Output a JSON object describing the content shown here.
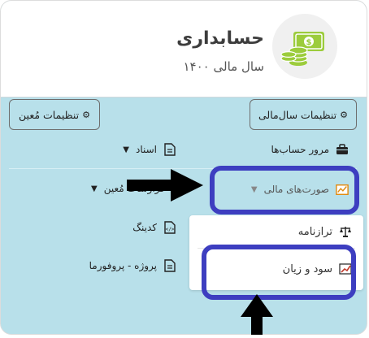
{
  "app": {
    "title": "حسابداری",
    "subtitle": "سال مالی ۱۴۰۰"
  },
  "toolbar": {
    "fiscal_settings_label": "تنظیمات سال‌مالی",
    "moein_settings_label": "تنظیمات مُعین"
  },
  "menu": {
    "accounts_overview": "مرور حساب‌ها",
    "documents": "اسناد",
    "financial_statements": "صورت‌های مالی",
    "moein_reports": "گزارشات مُعین",
    "coding": "کدینگ",
    "project_proforma": "پروژه - پروفورما"
  },
  "dropdown": {
    "balance_sheet": "ترازنامه",
    "profit_loss": "سود و زیان"
  },
  "colors": {
    "panel_bg": "#b8e0ea",
    "highlight_ring": "#3d3ec0",
    "logo_green": "#9ccc3c"
  }
}
